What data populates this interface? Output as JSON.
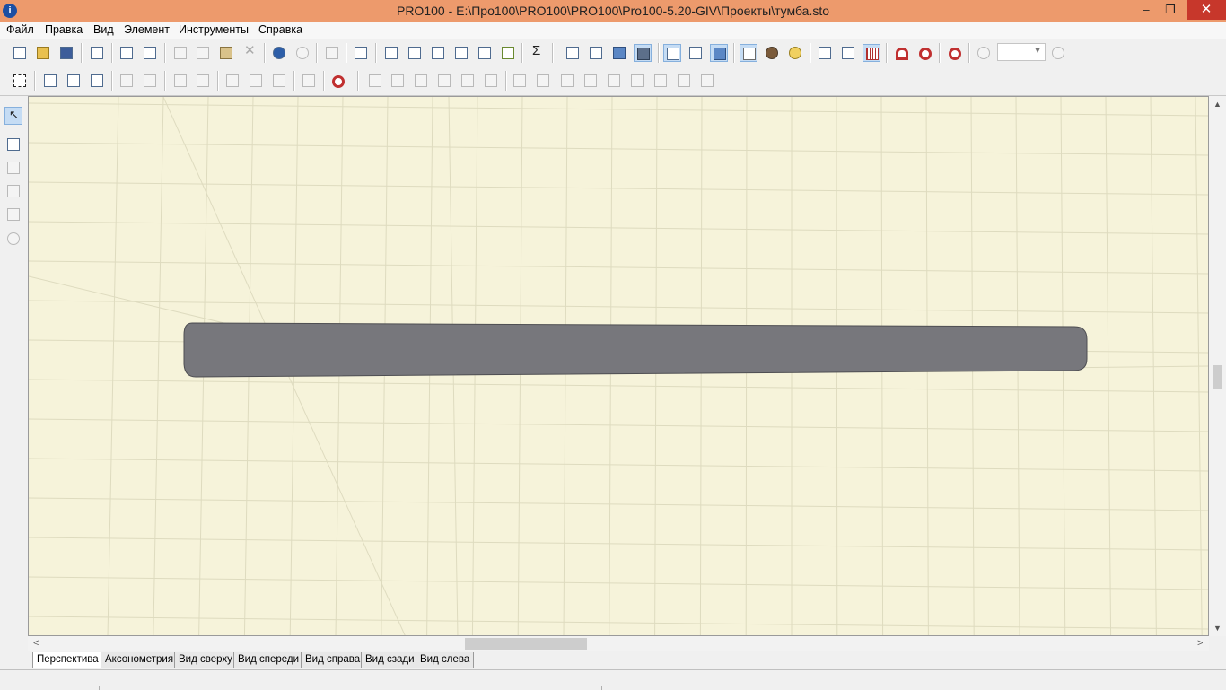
{
  "window": {
    "title": "PRO100 - E:\\Про100\\PRO100\\PRO100\\Pro100-5.20-GIV\\Проекты\\тумба.sto",
    "app_icon": "i"
  },
  "title_buttons": {
    "minimize": "–",
    "restore": "❐",
    "close": "✕"
  },
  "menu": [
    "Файл",
    "Правка",
    "Вид",
    "Элемент",
    "Инструменты",
    "Справка"
  ],
  "view_tabs": [
    "Перспектива",
    "Аксонометрия",
    "Вид сверху",
    "Вид спереди",
    "Вид справа",
    "Вид сзади",
    "Вид слева"
  ],
  "active_tab_index": 0,
  "toolbar_icons": {
    "sum": "Σ",
    "zoom_value": ""
  },
  "scroll_arrows": {
    "up": "▲",
    "down": "▼",
    "left": "<",
    "right": ">"
  },
  "colors": {
    "titlebar": "#ed9a6c",
    "viewport_bg": "#f6f3da",
    "panel_fill": "#77777c",
    "close_button": "#c7372b"
  }
}
